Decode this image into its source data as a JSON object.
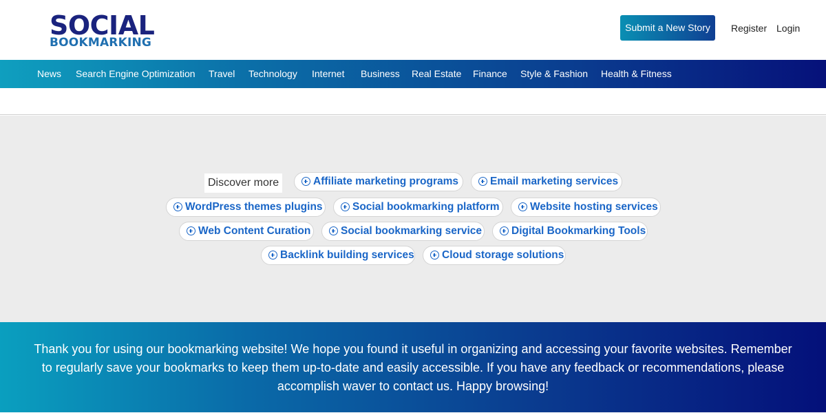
{
  "header": {
    "logo_top": "SOCIAL",
    "logo_bottom": "BOOKMARKING",
    "submit_label": "Submit a New Story",
    "register_label": "Register",
    "login_label": "Login"
  },
  "nav": {
    "items": [
      "News",
      "Search Engine Optimization",
      "Travel",
      "Technology",
      "Internet",
      "Business",
      "Real Estate",
      "Finance",
      "Style & Fashion",
      "Health & Fitness"
    ]
  },
  "discover": {
    "label": "Discover more",
    "chips": [
      "Affiliate marketing programs",
      "Email marketing services",
      "WordPress themes plugins",
      "Social bookmarking platform",
      "Website hosting services",
      "Web Content Curation",
      "Social bookmarking service",
      "Digital Bookmarking Tools",
      "Backlink building services",
      "Cloud storage solutions"
    ]
  },
  "footer": {
    "text": "Thank you for using our bookmarking website! We hope you found it useful in organizing and accessing your favorite websites. Remember to regularly save your bookmarks to keep them up-to-date and easily accessible. If you have any feedback or recommendations, please accomplish waver to contact us. Happy browsing!"
  },
  "colors": {
    "brand_navy": "#1a237e",
    "brand_blue": "#1f6fb0",
    "chip_text": "#1a66c7",
    "gradient_start": "#0a9fbf",
    "gradient_end": "#04107a"
  }
}
